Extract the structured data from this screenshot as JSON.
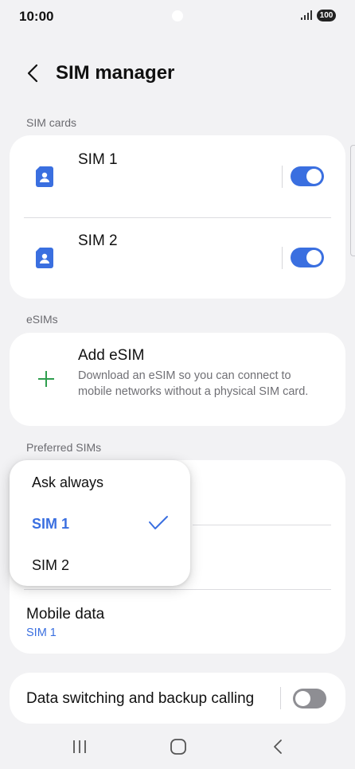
{
  "status_bar": {
    "time": "10:00",
    "battery": "100"
  },
  "header": {
    "title": "SIM manager"
  },
  "sections": {
    "sim_cards": "SIM cards",
    "esims": "eSIMs",
    "preferred": "Preferred SIMs"
  },
  "sim_cards": [
    {
      "name": "SIM 1",
      "enabled": true
    },
    {
      "name": "SIM 2",
      "enabled": true
    }
  ],
  "add_esim": {
    "title": "Add eSIM",
    "description": "Download an eSIM so you can connect to mobile networks without a physical SIM card."
  },
  "preferred": {
    "mobile_data_label": "Mobile data",
    "mobile_data_value": "SIM 1"
  },
  "popup": {
    "options": [
      "Ask always",
      "SIM 1",
      "SIM 2"
    ],
    "selected": "SIM 1"
  },
  "data_switching": {
    "label": "Data switching and backup calling",
    "enabled": false
  },
  "colors": {
    "accent": "#3a6fe0",
    "add_icon": "#2e9e4e",
    "background": "#f2f2f4"
  },
  "icons": [
    "back-arrow-icon",
    "sim-card-icon",
    "plus-icon",
    "check-icon",
    "recent-apps-icon",
    "home-icon",
    "back-icon"
  ]
}
